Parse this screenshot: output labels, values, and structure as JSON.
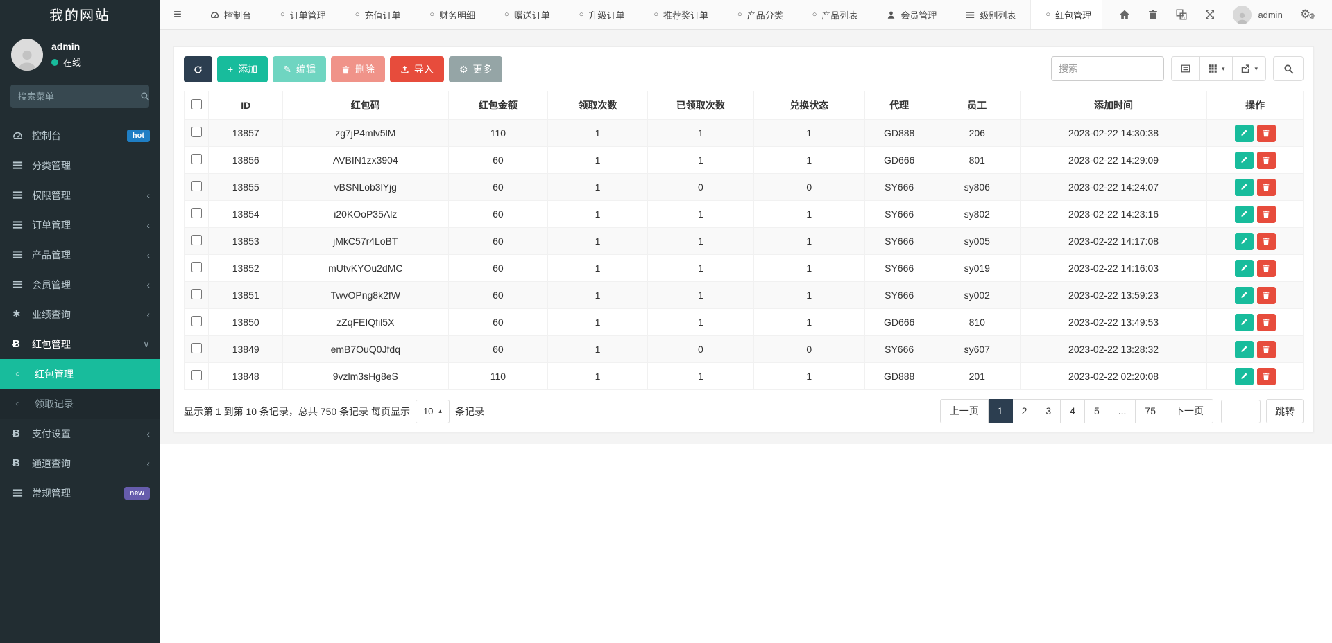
{
  "sidebar": {
    "title": "我的网站",
    "user": {
      "name": "admin",
      "status": "在线"
    },
    "search_placeholder": "搜索菜单",
    "items": [
      {
        "label": "控制台",
        "icon": "dashboard-icon",
        "badge": "hot"
      },
      {
        "label": "分类管理",
        "icon": "list-icon"
      },
      {
        "label": "权限管理",
        "icon": "list-icon",
        "chevron": "left"
      },
      {
        "label": "订单管理",
        "icon": "list-icon",
        "chevron": "left"
      },
      {
        "label": "产品管理",
        "icon": "list-icon",
        "chevron": "left"
      },
      {
        "label": "会员管理",
        "icon": "list-icon",
        "chevron": "left"
      },
      {
        "label": "业绩查询",
        "icon": "asterisk-icon",
        "chevron": "left"
      },
      {
        "label": "红包管理",
        "icon": "bitcoin-icon",
        "chevron": "down",
        "open": true
      },
      {
        "label": "红包管理",
        "icon": "circle-icon",
        "sub": true,
        "active": true
      },
      {
        "label": "领取记录",
        "icon": "circle-icon",
        "sub": true
      },
      {
        "label": "支付设置",
        "icon": "bitcoin-icon",
        "chevron": "left"
      },
      {
        "label": "通道查询",
        "icon": "bitcoin-icon",
        "chevron": "left"
      },
      {
        "label": "常规管理",
        "icon": "list-icon",
        "badge": "new"
      }
    ]
  },
  "navbar": {
    "tabs": [
      {
        "label": "控制台",
        "icon": "dashboard-icon"
      },
      {
        "label": "订单管理",
        "icon": "circle-icon"
      },
      {
        "label": "充值订单",
        "icon": "circle-icon"
      },
      {
        "label": "财务明细",
        "icon": "circle-icon"
      },
      {
        "label": "赠送订单",
        "icon": "circle-icon"
      },
      {
        "label": "升级订单",
        "icon": "circle-icon"
      },
      {
        "label": "推荐奖订单",
        "icon": "circle-icon"
      },
      {
        "label": "产品分类",
        "icon": "circle-icon"
      },
      {
        "label": "产品列表",
        "icon": "circle-icon"
      },
      {
        "label": "会员管理",
        "icon": "person-icon"
      },
      {
        "label": "级别列表",
        "icon": "list-icon"
      },
      {
        "label": "红包管理",
        "icon": "circle-icon",
        "active": true
      }
    ],
    "user": "admin"
  },
  "toolbar": {
    "add_label": "添加",
    "edit_label": "编辑",
    "delete_label": "删除",
    "import_label": "导入",
    "more_label": "更多",
    "search_placeholder": "搜索"
  },
  "table": {
    "columns": [
      "ID",
      "红包码",
      "红包金额",
      "领取次数",
      "已领取次数",
      "兑换状态",
      "代理",
      "员工",
      "添加时间",
      "操作"
    ],
    "rows": [
      {
        "id": "13857",
        "code": "zg7jP4mlv5lM",
        "amount": "110",
        "times": "1",
        "claimed": "1",
        "status": "1",
        "agent": "GD888",
        "staff": "206",
        "time": "2023-02-22 14:30:38"
      },
      {
        "id": "13856",
        "code": "AVBIN1zx3904",
        "amount": "60",
        "times": "1",
        "claimed": "1",
        "status": "1",
        "agent": "GD666",
        "staff": "801",
        "time": "2023-02-22 14:29:09"
      },
      {
        "id": "13855",
        "code": "vBSNLob3lYjg",
        "amount": "60",
        "times": "1",
        "claimed": "0",
        "status": "0",
        "agent": "SY666",
        "staff": "sy806",
        "time": "2023-02-22 14:24:07"
      },
      {
        "id": "13854",
        "code": "i20KOoP35Alz",
        "amount": "60",
        "times": "1",
        "claimed": "1",
        "status": "1",
        "agent": "SY666",
        "staff": "sy802",
        "time": "2023-02-22 14:23:16"
      },
      {
        "id": "13853",
        "code": "jMkC57r4LoBT",
        "amount": "60",
        "times": "1",
        "claimed": "1",
        "status": "1",
        "agent": "SY666",
        "staff": "sy005",
        "time": "2023-02-22 14:17:08"
      },
      {
        "id": "13852",
        "code": "mUtvKYOu2dMC",
        "amount": "60",
        "times": "1",
        "claimed": "1",
        "status": "1",
        "agent": "SY666",
        "staff": "sy019",
        "time": "2023-02-22 14:16:03"
      },
      {
        "id": "13851",
        "code": "TwvOPng8k2fW",
        "amount": "60",
        "times": "1",
        "claimed": "1",
        "status": "1",
        "agent": "SY666",
        "staff": "sy002",
        "time": "2023-02-22 13:59:23"
      },
      {
        "id": "13850",
        "code": "zZqFEIQfil5X",
        "amount": "60",
        "times": "1",
        "claimed": "1",
        "status": "1",
        "agent": "GD666",
        "staff": "810",
        "time": "2023-02-22 13:49:53"
      },
      {
        "id": "13849",
        "code": "emB7OuQ0Jfdq",
        "amount": "60",
        "times": "1",
        "claimed": "0",
        "status": "0",
        "agent": "SY666",
        "staff": "sy607",
        "time": "2023-02-22 13:28:32"
      },
      {
        "id": "13848",
        "code": "9vzlm3sHg8eS",
        "amount": "110",
        "times": "1",
        "claimed": "1",
        "status": "1",
        "agent": "GD888",
        "staff": "201",
        "time": "2023-02-22 02:20:08"
      }
    ]
  },
  "footer": {
    "summary_prefix": "显示第 1 到第 10 条记录，总共 750 条记录 每页显示",
    "page_size": "10",
    "summary_suffix": "条记录",
    "pagination": {
      "prev": "上一页",
      "pages": [
        "1",
        "2",
        "3",
        "4",
        "5",
        "...",
        "75"
      ],
      "active_page": "1",
      "next": "下一页",
      "jump_label": "跳转",
      "jump_value": ""
    }
  },
  "colors": {
    "sidebar_bg": "#222d32",
    "active_teal": "#18bc9c",
    "primary_navy": "#2c3e50",
    "danger_red": "#e74c3c",
    "neutral_gray": "#95a5a6",
    "hot_badge": "#1f7ec4",
    "new_badge": "#665cac"
  }
}
